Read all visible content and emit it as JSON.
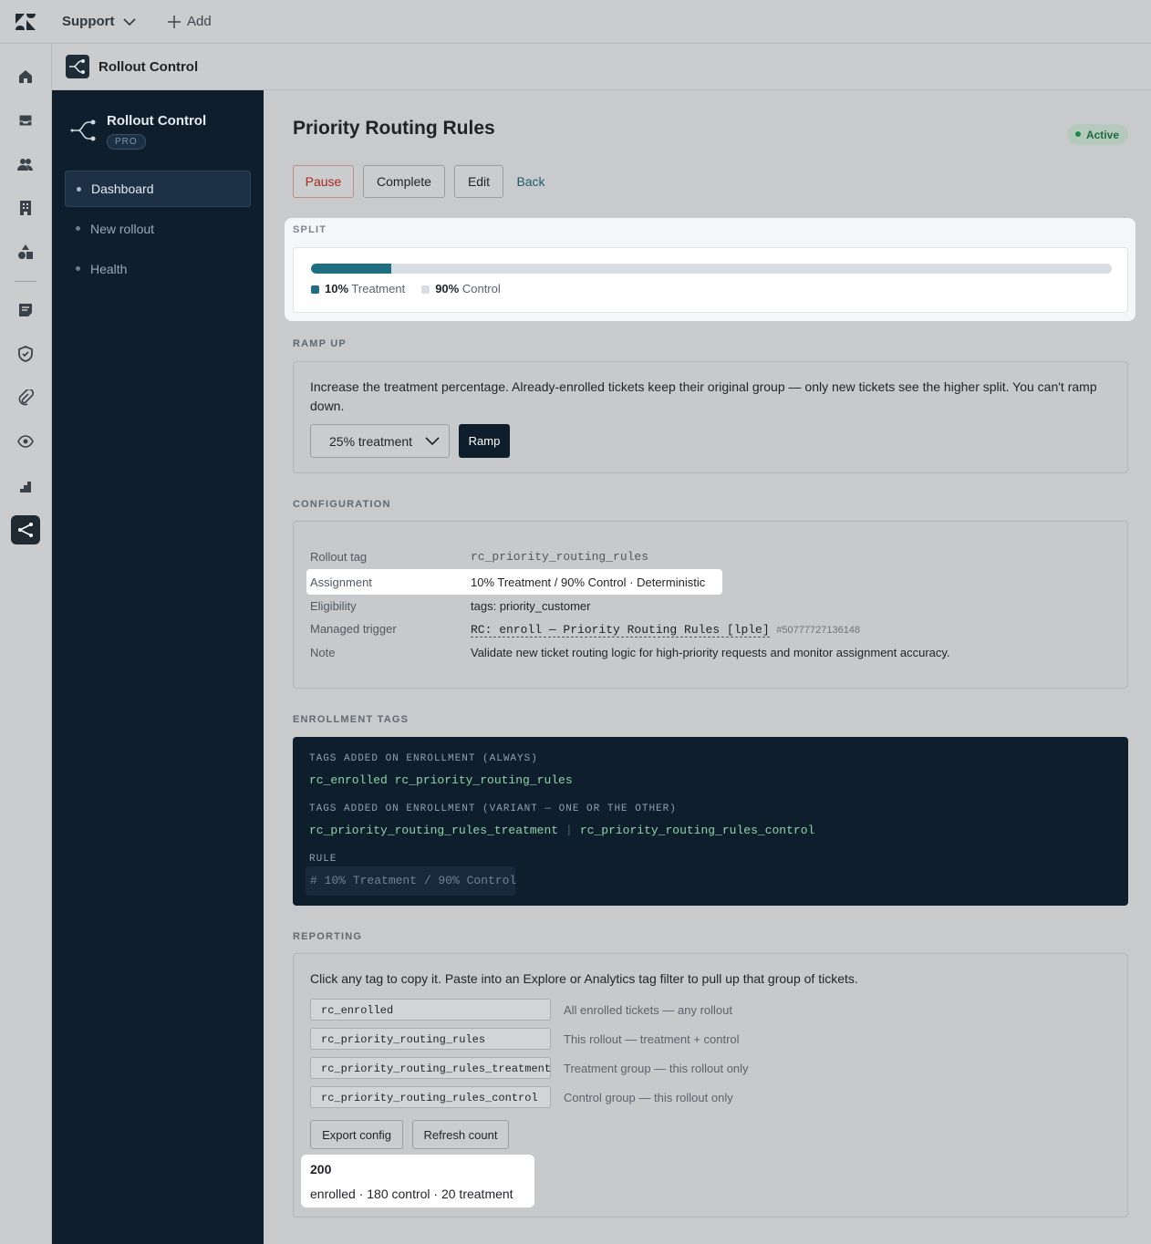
{
  "topbar": {
    "product": "Support",
    "add_label": "Add"
  },
  "app": {
    "title": "Rollout Control",
    "badge": "PRO"
  },
  "sidebar": {
    "items": [
      {
        "label": "Dashboard",
        "active": true
      },
      {
        "label": "New rollout",
        "active": false
      },
      {
        "label": "Health",
        "active": false
      }
    ]
  },
  "page": {
    "title": "Priority Routing Rules",
    "status": "Active"
  },
  "actions": {
    "pause": "Pause",
    "complete": "Complete",
    "edit": "Edit",
    "back": "Back"
  },
  "split": {
    "label": "SPLIT",
    "treatment_fraction": 0.1,
    "treatment_pct": "10%",
    "treatment_label": "Treatment",
    "control_pct": "90%",
    "control_label": "Control",
    "colors": {
      "treatment": "#1f6f80",
      "control": "#d8dde3"
    }
  },
  "ramp": {
    "label": "RAMP UP",
    "text": "Increase the treatment percentage. Already-enrolled tickets keep their original group — only new tickets see the higher split. You can't ramp down.",
    "select_value": "25% treatment",
    "button": "Ramp"
  },
  "config": {
    "label": "CONFIGURATION",
    "rows": [
      {
        "key": "Rollout tag",
        "value": "rc_priority_routing_rules"
      },
      {
        "key": "Assignment",
        "value": "10% Treatment / 90% Control · Deterministic"
      },
      {
        "key": "Eligibility",
        "value": "tags: priority_customer"
      },
      {
        "key": "Managed trigger",
        "value": "RC: enroll — Priority Routing Rules [lple]",
        "id": "#50777727136148"
      },
      {
        "key": "Note",
        "value": "Validate new ticket routing logic for high-priority requests and monitor assignment accuracy."
      }
    ]
  },
  "enrollment": {
    "label": "ENROLLMENT TAGS",
    "always_label": "TAGS ADDED ON ENROLLMENT (ALWAYS)",
    "always_tags": "rc_enrolled rc_priority_routing_rules",
    "variant_label": "TAGS ADDED ON ENROLLMENT (VARIANT — ONE OR THE OTHER)",
    "variant_a": "rc_priority_routing_rules_treatment",
    "variant_sep": "|",
    "variant_b": "rc_priority_routing_rules_control",
    "rule_label": "RULE",
    "rule": "# 10% Treatment / 90% Control"
  },
  "reporting": {
    "label": "REPORTING",
    "text": "Click any tag to copy it. Paste into an Explore or Analytics tag filter to pull up that group of tickets.",
    "tags": [
      {
        "tag": "rc_enrolled",
        "desc": "All enrolled tickets — any rollout"
      },
      {
        "tag": "rc_priority_routing_rules",
        "desc": "This rollout — treatment + control"
      },
      {
        "tag": "rc_priority_routing_rules_treatment",
        "desc": "Treatment group — this rollout only"
      },
      {
        "tag": "rc_priority_routing_rules_control",
        "desc": "Control group — this rollout only"
      }
    ],
    "export": "Export config",
    "refresh": "Refresh count",
    "count": "200",
    "count_detail": "enrolled · 180 control · 20 treatment"
  }
}
